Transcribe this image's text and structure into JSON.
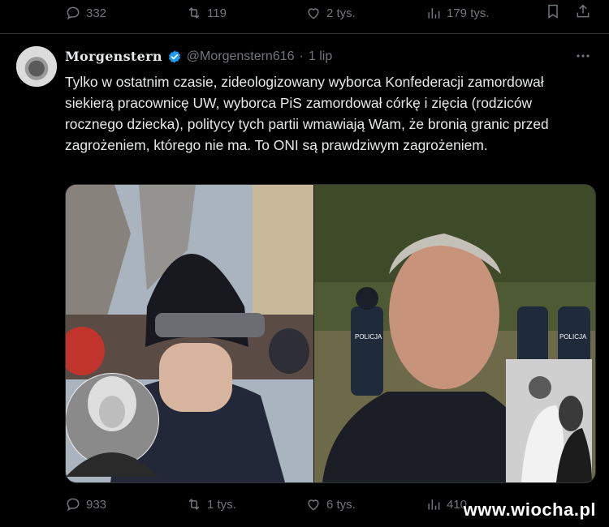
{
  "top_actions": {
    "replies": "332",
    "retweets": "119",
    "likes": "2 tys.",
    "views": "179 tys."
  },
  "tweet": {
    "display_name": "Morgenstern",
    "handle": "@Morgenstern616",
    "separator": "·",
    "time": "1 lip",
    "text": "Tylko w ostatnim czasie, zideologizowany wyborca Konfederacji zamordował siekierą pracownicę UW, wyborca PiS zamordował córkę i zięcia (rodziców rocznego dziecka), politycy tych partii wmawiają Wam, że bronią granic przed zagrożeniem, którego nie ma. To ONI są prawdziwym zagrożeniem.",
    "media_labels": {
      "police_1": "POLICJA",
      "police_2": "POLICJA"
    }
  },
  "bottom_actions": {
    "replies": "933",
    "retweets": "1 tys.",
    "likes": "6 tys.",
    "views": "410"
  },
  "watermark": "www.wiocha.pl",
  "colors": {
    "background": "#000000",
    "text": "#e7e9ea",
    "muted": "#71767b",
    "verified": "#1d9bf0",
    "divider": "#2f3336"
  }
}
